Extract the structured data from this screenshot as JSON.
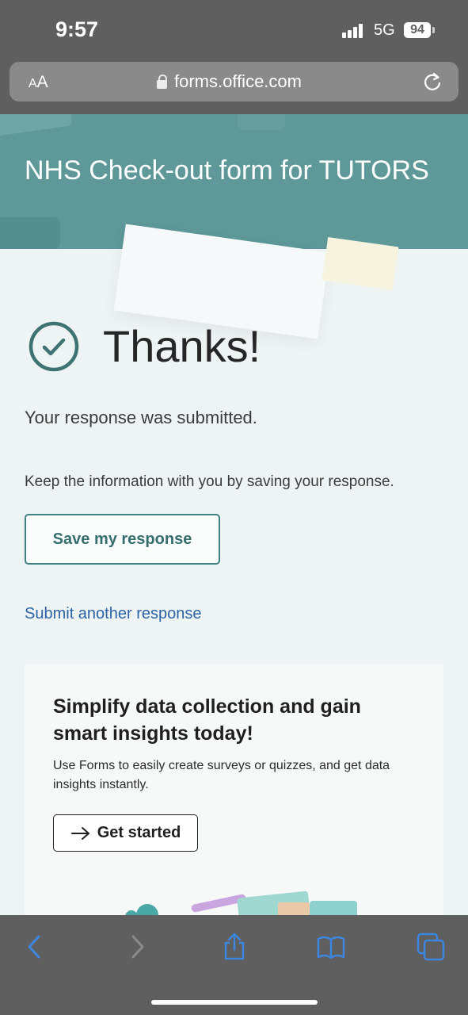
{
  "status_bar": {
    "time": "9:57",
    "network": "5G",
    "battery": "94"
  },
  "browser": {
    "text_size_label_big": "A",
    "text_size_label_small": "A",
    "url": "forms.office.com",
    "icons": [
      "lock-icon",
      "reload-icon"
    ]
  },
  "form": {
    "title": "NHS Check-out form for TUTORS"
  },
  "confirmation": {
    "heading": "Thanks!",
    "submitted_text": "Your response was submitted.",
    "keep_text": "Keep the information with you by saving your response.",
    "save_button": "Save my response",
    "submit_another": "Submit another response"
  },
  "promo": {
    "title": "Simplify data collection and gain smart insights today!",
    "description": "Use Forms to easily create surveys or quizzes, and get data insights instantly.",
    "button": "Get started"
  },
  "toolbar": {
    "icons": [
      "back-icon",
      "forward-icon",
      "share-icon",
      "bookmarks-icon",
      "tabs-icon"
    ]
  },
  "colors": {
    "accent": "#5e9898",
    "link": "#2c64a5",
    "toolbar_icon": "#3d86e0"
  }
}
